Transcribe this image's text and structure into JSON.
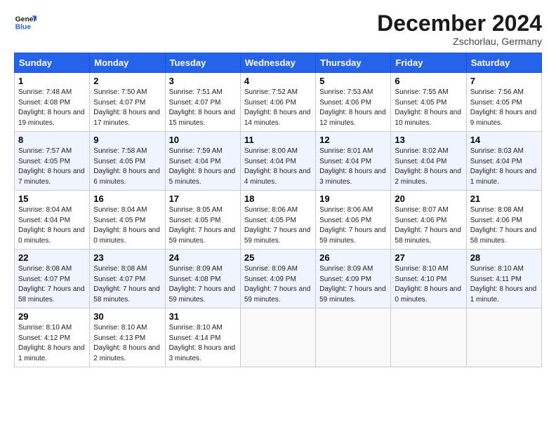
{
  "header": {
    "logo_line1": "General",
    "logo_line2": "Blue",
    "month": "December 2024",
    "location": "Zschorlau, Germany"
  },
  "days_of_week": [
    "Sunday",
    "Monday",
    "Tuesday",
    "Wednesday",
    "Thursday",
    "Friday",
    "Saturday"
  ],
  "weeks": [
    [
      {
        "day": "1",
        "sunrise": "7:48 AM",
        "sunset": "4:08 PM",
        "daylight": "8 hours and 19 minutes."
      },
      {
        "day": "2",
        "sunrise": "7:50 AM",
        "sunset": "4:07 PM",
        "daylight": "8 hours and 17 minutes."
      },
      {
        "day": "3",
        "sunrise": "7:51 AM",
        "sunset": "4:07 PM",
        "daylight": "8 hours and 15 minutes."
      },
      {
        "day": "4",
        "sunrise": "7:52 AM",
        "sunset": "4:06 PM",
        "daylight": "8 hours and 14 minutes."
      },
      {
        "day": "5",
        "sunrise": "7:53 AM",
        "sunset": "4:06 PM",
        "daylight": "8 hours and 12 minutes."
      },
      {
        "day": "6",
        "sunrise": "7:55 AM",
        "sunset": "4:05 PM",
        "daylight": "8 hours and 10 minutes."
      },
      {
        "day": "7",
        "sunrise": "7:56 AM",
        "sunset": "4:05 PM",
        "daylight": "8 hours and 9 minutes."
      }
    ],
    [
      {
        "day": "8",
        "sunrise": "7:57 AM",
        "sunset": "4:05 PM",
        "daylight": "8 hours and 7 minutes."
      },
      {
        "day": "9",
        "sunrise": "7:58 AM",
        "sunset": "4:05 PM",
        "daylight": "8 hours and 6 minutes."
      },
      {
        "day": "10",
        "sunrise": "7:59 AM",
        "sunset": "4:04 PM",
        "daylight": "8 hours and 5 minutes."
      },
      {
        "day": "11",
        "sunrise": "8:00 AM",
        "sunset": "4:04 PM",
        "daylight": "8 hours and 4 minutes."
      },
      {
        "day": "12",
        "sunrise": "8:01 AM",
        "sunset": "4:04 PM",
        "daylight": "8 hours and 3 minutes."
      },
      {
        "day": "13",
        "sunrise": "8:02 AM",
        "sunset": "4:04 PM",
        "daylight": "8 hours and 2 minutes."
      },
      {
        "day": "14",
        "sunrise": "8:03 AM",
        "sunset": "4:04 PM",
        "daylight": "8 hours and 1 minute."
      }
    ],
    [
      {
        "day": "15",
        "sunrise": "8:04 AM",
        "sunset": "4:04 PM",
        "daylight": "8 hours and 0 minutes."
      },
      {
        "day": "16",
        "sunrise": "8:04 AM",
        "sunset": "4:05 PM",
        "daylight": "8 hours and 0 minutes."
      },
      {
        "day": "17",
        "sunrise": "8:05 AM",
        "sunset": "4:05 PM",
        "daylight": "7 hours and 59 minutes."
      },
      {
        "day": "18",
        "sunrise": "8:06 AM",
        "sunset": "4:05 PM",
        "daylight": "7 hours and 59 minutes."
      },
      {
        "day": "19",
        "sunrise": "8:06 AM",
        "sunset": "4:06 PM",
        "daylight": "7 hours and 59 minutes."
      },
      {
        "day": "20",
        "sunrise": "8:07 AM",
        "sunset": "4:06 PM",
        "daylight": "7 hours and 58 minutes."
      },
      {
        "day": "21",
        "sunrise": "8:08 AM",
        "sunset": "4:06 PM",
        "daylight": "7 hours and 58 minutes."
      }
    ],
    [
      {
        "day": "22",
        "sunrise": "8:08 AM",
        "sunset": "4:07 PM",
        "daylight": "7 hours and 58 minutes."
      },
      {
        "day": "23",
        "sunrise": "8:08 AM",
        "sunset": "4:07 PM",
        "daylight": "7 hours and 58 minutes."
      },
      {
        "day": "24",
        "sunrise": "8:09 AM",
        "sunset": "4:08 PM",
        "daylight": "7 hours and 59 minutes."
      },
      {
        "day": "25",
        "sunrise": "8:09 AM",
        "sunset": "4:09 PM",
        "daylight": "7 hours and 59 minutes."
      },
      {
        "day": "26",
        "sunrise": "8:09 AM",
        "sunset": "4:09 PM",
        "daylight": "7 hours and 59 minutes."
      },
      {
        "day": "27",
        "sunrise": "8:10 AM",
        "sunset": "4:10 PM",
        "daylight": "8 hours and 0 minutes."
      },
      {
        "day": "28",
        "sunrise": "8:10 AM",
        "sunset": "4:11 PM",
        "daylight": "8 hours and 1 minute."
      }
    ],
    [
      {
        "day": "29",
        "sunrise": "8:10 AM",
        "sunset": "4:12 PM",
        "daylight": "8 hours and 1 minute."
      },
      {
        "day": "30",
        "sunrise": "8:10 AM",
        "sunset": "4:13 PM",
        "daylight": "8 hours and 2 minutes."
      },
      {
        "day": "31",
        "sunrise": "8:10 AM",
        "sunset": "4:14 PM",
        "daylight": "8 hours and 3 minutes."
      },
      null,
      null,
      null,
      null
    ]
  ]
}
